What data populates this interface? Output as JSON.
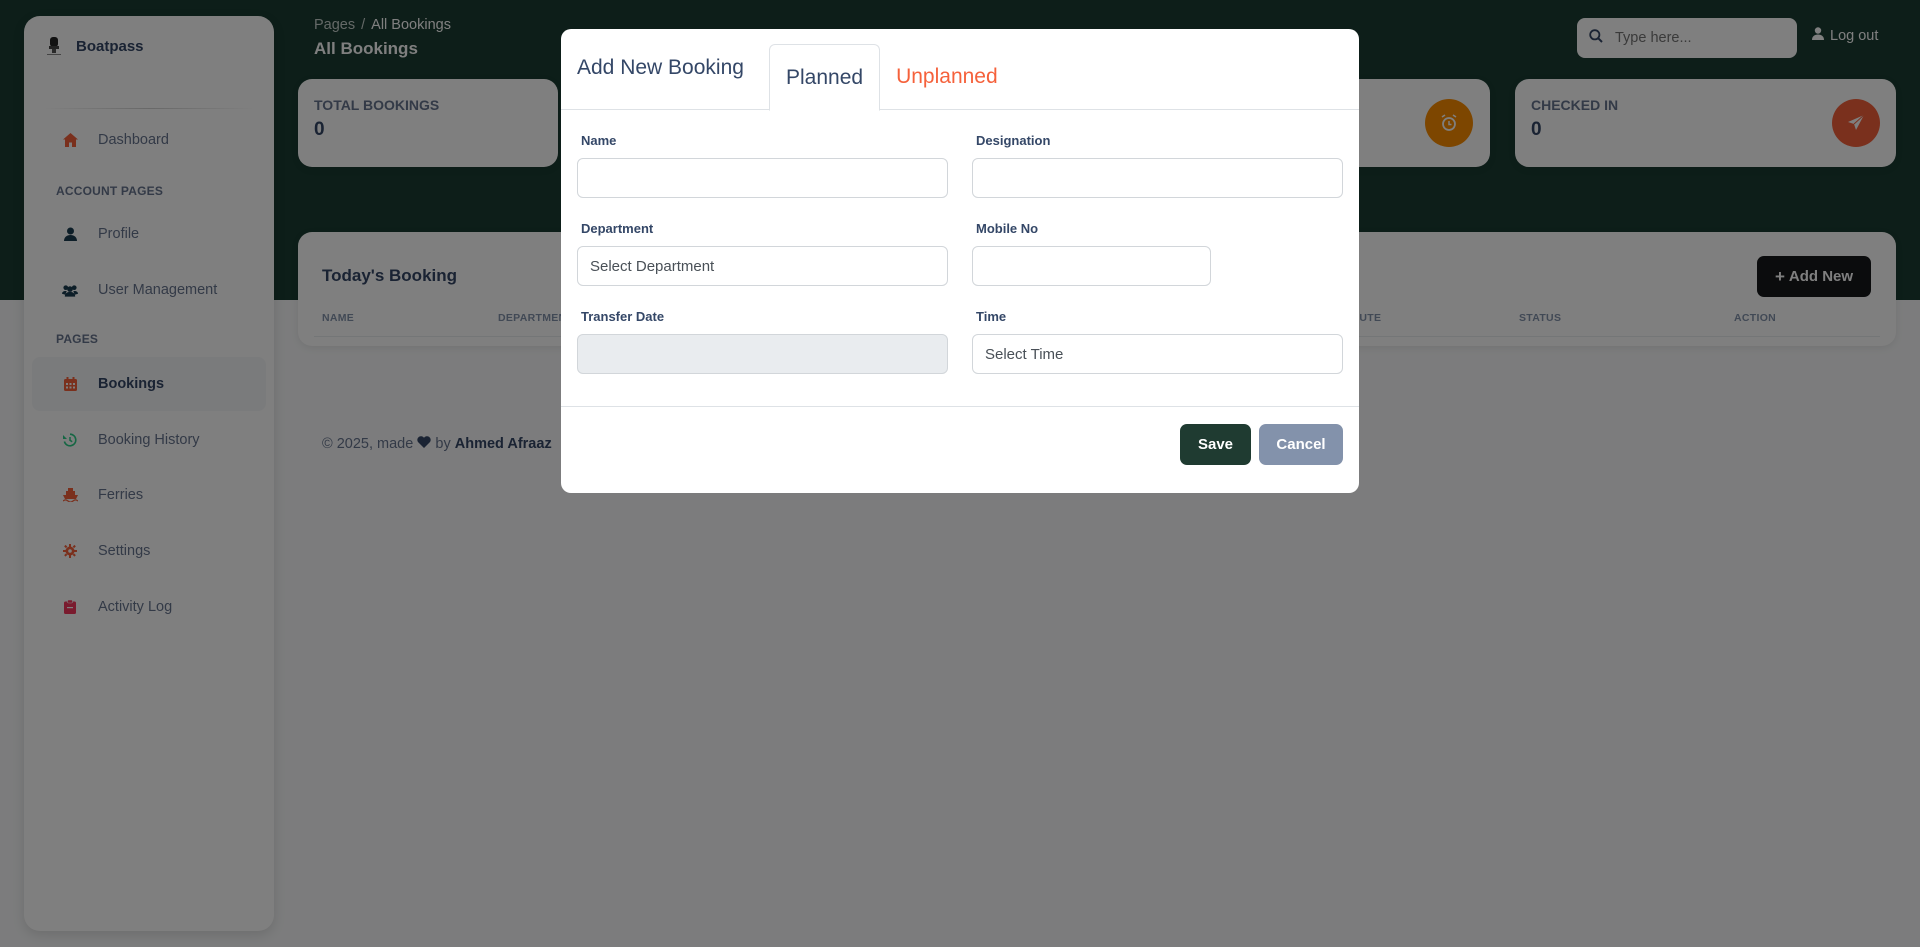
{
  "brand": {
    "name": "Boatpass"
  },
  "sidebar": {
    "items": [
      {
        "label": "Dashboard",
        "icon": "home-icon"
      },
      {
        "label": "Profile",
        "icon": "user-icon"
      },
      {
        "label": "User Management",
        "icon": "users-icon"
      },
      {
        "label": "Bookings",
        "icon": "calendar-icon",
        "active": true
      },
      {
        "label": "Booking History",
        "icon": "history-icon"
      },
      {
        "label": "Ferries",
        "icon": "ship-icon"
      },
      {
        "label": "Settings",
        "icon": "gear-icon"
      },
      {
        "label": "Activity Log",
        "icon": "clipboard-icon"
      }
    ],
    "sections": {
      "account": "ACCOUNT PAGES",
      "pages": "PAGES"
    }
  },
  "header": {
    "breadcrumb_root": "Pages",
    "breadcrumb_sep": "/",
    "breadcrumb_current": "All Bookings",
    "title": "All Bookings",
    "search_placeholder": "Type here...",
    "logout": "Log out"
  },
  "stats": [
    {
      "label": "TOTAL BOOKINGS",
      "value": "0"
    },
    {
      "label": "CHECKED IN",
      "value": "0"
    }
  ],
  "table": {
    "title": "Today's Booking",
    "add_new": "Add New",
    "columns": [
      "NAME",
      "DEPARTMENT",
      "ROUTE",
      "STATUS",
      "ACTION"
    ]
  },
  "footer": {
    "prefix": "© 2025, made",
    "by": "by",
    "author": "Ahmed Afraaz"
  },
  "modal": {
    "title": "Add New Booking",
    "tabs": [
      "Planned",
      "Unplanned"
    ],
    "fields": {
      "name_label": "Name",
      "designation_label": "Designation",
      "department_label": "Department",
      "department_value": "Select Department",
      "mobile_label": "Mobile No",
      "transfer_date_label": "Transfer Date",
      "time_label": "Time",
      "time_value": "Select Time"
    },
    "save": "Save",
    "cancel": "Cancel"
  },
  "colors": {
    "header_bg": "#1a3c32",
    "accent_orange": "#f5613b",
    "save_bg": "#1f3b31",
    "cancel_bg": "#8392ab"
  }
}
